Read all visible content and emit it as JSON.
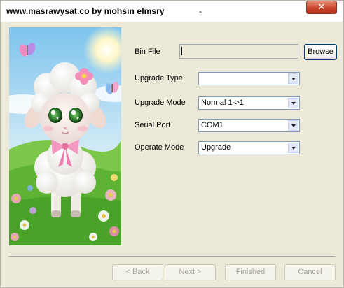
{
  "window": {
    "title": "www.masrawysat.co by mohsin elmsry",
    "title_suffix": "-",
    "close_glyph": "✕"
  },
  "fields": {
    "bin_file": {
      "label": "Bin File",
      "value": ""
    },
    "upgrade_type": {
      "label": "Upgrade Type",
      "value": ""
    },
    "upgrade_mode": {
      "label": "Upgrade Mode",
      "value": "Normal 1->1"
    },
    "serial_port": {
      "label": "Serial Port",
      "value": "COM1"
    },
    "operate_mode": {
      "label": "Operate Mode",
      "value": "Upgrade"
    }
  },
  "buttons": {
    "browse": "Browse",
    "back": "< Back",
    "next": "Next >",
    "finished": "Finished",
    "cancel": "Cancel"
  },
  "image": {
    "subject": "cartoon-lamb-illustration"
  }
}
